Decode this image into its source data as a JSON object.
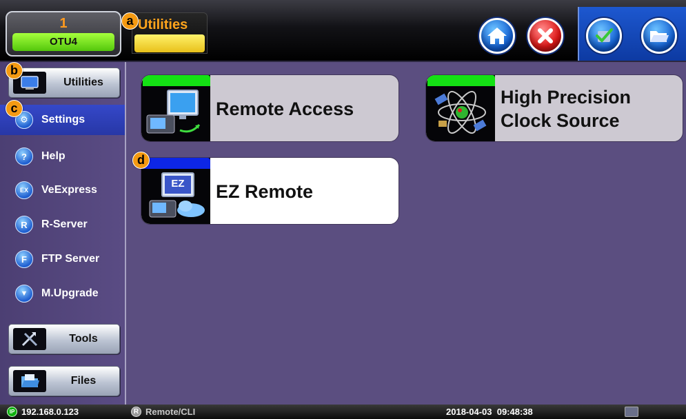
{
  "port": {
    "number": "1",
    "label": "OTU4"
  },
  "header": {
    "title": "Utilities"
  },
  "toolbar": {
    "home_icon": "home-icon",
    "close_icon": "close-icon",
    "check_icon": "checkmark-icon",
    "folder_icon": "folder-open-icon"
  },
  "sidebar": {
    "utilities_label": "Utilities",
    "items": [
      {
        "label": "Settings",
        "icon": "settings-icon",
        "selected": true
      },
      {
        "label": "Help",
        "icon": "help-icon",
        "glyph": "?"
      },
      {
        "label": "VeExpress",
        "icon": "veexpress-icon",
        "glyph": "EX"
      },
      {
        "label": "R-Server",
        "icon": "rserver-icon",
        "glyph": "R"
      },
      {
        "label": "FTP Server",
        "icon": "ftp-server-icon",
        "glyph": "F"
      },
      {
        "label": "M.Upgrade",
        "icon": "upgrade-icon",
        "glyph": "▼"
      }
    ],
    "tools_label": "Tools",
    "files_label": "Files"
  },
  "tiles": [
    {
      "label": "Remote Access",
      "icon": "remote-access-icon",
      "strip_color": "#14e114"
    },
    {
      "label": "High Precision Clock Source",
      "icon": "atom-clock-icon",
      "strip_color": "#14e114"
    },
    {
      "label": "EZ Remote",
      "icon": "ez-remote-icon",
      "strip_color": "#0d26e6",
      "icon_text": "EZ"
    }
  ],
  "badges": [
    "a",
    "b",
    "c",
    "d"
  ],
  "statusbar": {
    "ip_glyph": "IP",
    "ip": "192.168.0.123",
    "remote_glyph": "R",
    "remote": "Remote/CLI",
    "datetime": "2018-04-03  09:48:38"
  },
  "colors": {
    "background": "#5b4e80",
    "accent_orange": "#ffa41c",
    "status_green": "#14e114",
    "status_blue": "#0d26e6"
  }
}
